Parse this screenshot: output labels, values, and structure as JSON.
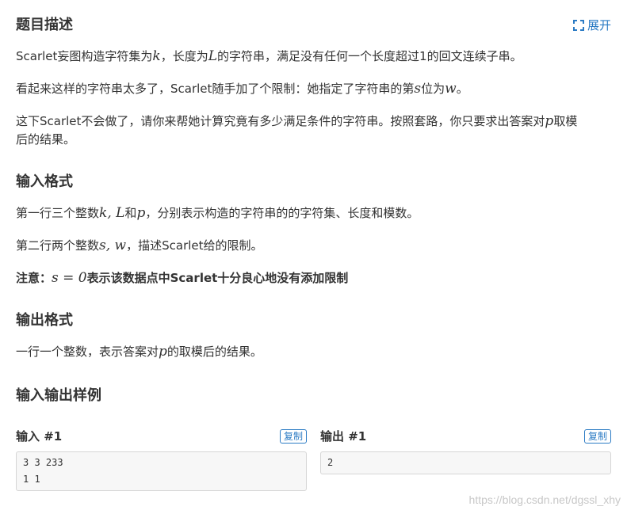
{
  "description": {
    "title": "题目描述",
    "expand_label": "展开",
    "p1": {
      "a": "Scarlet妄图构造字符集为",
      "k": "k",
      "b": "，长度为",
      "L": "L",
      "c": "的字符串，满足没有任何一个长度超过1的回文连续子串。"
    },
    "p2": {
      "a": "看起来这样的字符串太多了，Scarlet随手加了个限制：她指定了字符串的第",
      "s": "s",
      "b": "位为",
      "w": "w",
      "c": "。"
    },
    "p3": {
      "a": "这下Scarlet不会做了，请你来帮她计算究竟有多少满足条件的字符串。按照套路，你只要求出答案对",
      "p": "p",
      "b": "取模",
      "c": "后的结果。"
    }
  },
  "input_format": {
    "title": "输入格式",
    "p1": {
      "a": "第一行三个整数",
      "math": "k, L",
      "b": "和",
      "p": "p",
      "c": "，分别表示构造的字符串的的字符集、长度和模数。"
    },
    "p2": {
      "a": "第二行两个整数",
      "math": "s, w",
      "b": "，描述Scarlet给的限制。"
    },
    "note": {
      "a": "注意：",
      "math": "s = 0",
      "b": "表示该数据点中Scarlet十分良心地没有添加限制"
    }
  },
  "output_format": {
    "title": "输出格式",
    "p1": {
      "a": "一行一个整数，表示答案对",
      "p": "p",
      "b": "的取模后的结果。"
    }
  },
  "samples": {
    "title": "输入输出样例",
    "input_title": "输入 #1",
    "output_title": "输出 #1",
    "copy_label": "复制",
    "input_text": "3 3 233\n1 1",
    "output_text": "2"
  },
  "watermark": "https://blog.csdn.net/dgssl_xhy",
  "colors": {
    "accent": "#2b7bc4",
    "text": "#333333"
  }
}
